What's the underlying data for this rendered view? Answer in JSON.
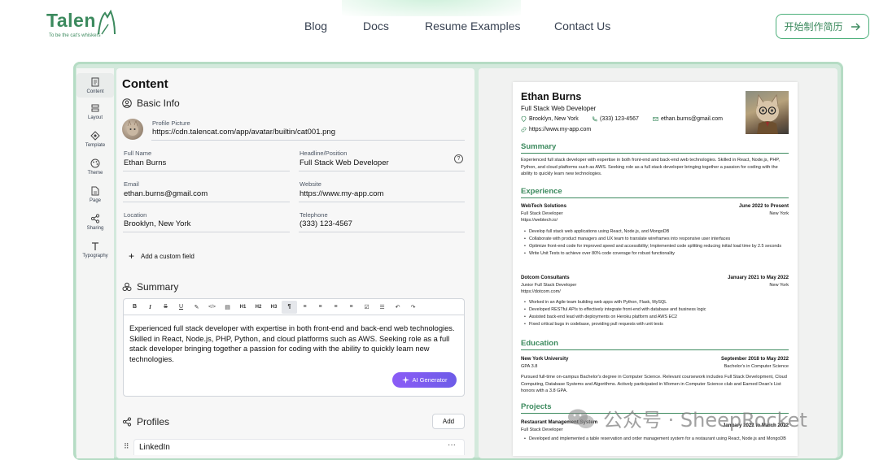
{
  "brand": {
    "name": "Talen",
    "tagline": "To be the cat's whiskers"
  },
  "nav": {
    "links": [
      "Blog",
      "Docs",
      "Resume Examples",
      "Contact Us"
    ],
    "cta": "开始制作简历"
  },
  "rail": {
    "items": [
      {
        "label": "Content",
        "icon": "document-icon"
      },
      {
        "label": "Layout",
        "icon": "layout-icon"
      },
      {
        "label": "Template",
        "icon": "template-icon"
      },
      {
        "label": "Theme",
        "icon": "palette-icon"
      },
      {
        "label": "Page",
        "icon": "page-icon"
      },
      {
        "label": "Sharing",
        "icon": "share-icon"
      },
      {
        "label": "Typography",
        "icon": "type-icon"
      }
    ]
  },
  "editor": {
    "heading": "Content",
    "basic_info": {
      "title": "Basic Info",
      "profile_picture_label": "Profile Picture",
      "profile_picture_value": "https://cdn.talencat.com/app/avatar/builtin/cat001.png",
      "full_name_label": "Full Name",
      "full_name_value": "Ethan Burns",
      "headline_label": "Headline/Position",
      "headline_value": "Full Stack Web Developer",
      "email_label": "Email",
      "email_value": "ethan.burns@gmail.com",
      "website_label": "Website",
      "website_value": "https://www.my-app.com",
      "location_label": "Location",
      "location_value": "Brooklyn, New York",
      "telephone_label": "Telephone",
      "telephone_value": "(333) 123-4567",
      "add_custom": "Add a custom field"
    },
    "summary": {
      "title": "Summary",
      "toolbar": [
        "B",
        "I",
        "S",
        "U",
        "✎",
        "</>",
        "▤",
        "H1",
        "H2",
        "H3",
        "¶",
        "≡",
        "≡",
        "≡",
        "≡",
        "☑",
        "☰",
        "↶",
        "↷"
      ],
      "text": "Experienced full stack developer with expertise in both front-end and back-end web technologies. Skilled in React, Node.js, PHP, Python, and cloud platforms such as AWS. Seeking role as a full stack developer bringing together a passion for coding with the ability to quickly learn new technologies.",
      "ai_button": "AI Generator"
    },
    "profiles": {
      "title": "Profiles",
      "add": "Add",
      "first": "LinkedIn",
      "more": "···"
    }
  },
  "resume": {
    "name": "Ethan Burns",
    "title": "Full Stack Web Developer",
    "location": "Brooklyn, New York",
    "phone": "(333) 123-4567",
    "email": "ethan.burns@gmail.com",
    "website": "https://www.my-app.com",
    "summary_heading": "Summary",
    "summary_text": "Experienced full stack developer with expertise in both front-end and back-end web technologies. Skilled in React, Node.js, PHP, Python, and cloud platforms such as AWS. Seeking role as a full stack developer bringing together a passion for coding with the ability to quickly learn new technologies.",
    "experience_heading": "Experience",
    "jobs": [
      {
        "company": "WebTech Solutions",
        "dates": "June 2022 to Present",
        "role": "Full Stack Developer",
        "location": "New York",
        "url": "https://webtech.io/",
        "bullets": [
          "Develop full stack web applications using React, Node.js, and MongoDB",
          "Collaborate with product managers and UX team to translate wireframes into responsive user interfaces",
          "Optimize front-end code for improved speed and accessibility; Implemented code splitting reducing initial load time by 2.5 seconds",
          "Write Unit Tests to achieve over 80% code coverage for robust functionality"
        ]
      },
      {
        "company": "Dotcom Consultants",
        "dates": "January 2021 to May 2022",
        "role": "Junior Full Stack Developer",
        "location": "New York",
        "url": "https://dotcom.com/",
        "bullets": [
          "Worked in an Agile team building web apps with Python, Flask, MySQL",
          "Developed RESTful APIs to effectively integrate front-end with database and business logic",
          "Assisted back-end lead with deployments on Heroku platform and AWS EC2",
          "Fixed critical bugs in codebase, providing pull requests with unit tests"
        ]
      }
    ],
    "education_heading": "Education",
    "education": {
      "school": "New York University",
      "dates": "September 2018 to May 2022",
      "gpa": "GPA 3.8",
      "degree": "Bachelor's in Computer Science",
      "text": "Pursued full-time on-campus Bachelor's degree in Computer Science. Relevant coursework includes Full Stack Development, Cloud Computing, Database Systems and Algorithms. Actively participated in Women in Computer Science club and Earned Dean's List honors with a 3.8 GPA."
    },
    "projects_heading": "Projects",
    "project": {
      "name": "Restaurant Management System",
      "dates": "January 2022 to March 2022",
      "role": "Full Stack Developer",
      "bullet": "Developed and implemented a table reservation and order management system for a restaurant using React, Node.js and MongoDB"
    }
  },
  "watermark": {
    "text": "公众号 · SheepRocket"
  },
  "colors": {
    "accent": "#3c8a5e",
    "frame": "#d3e9dc",
    "ai_gradient_start": "#8b5cf6",
    "ai_gradient_end": "#6d5ce8"
  }
}
